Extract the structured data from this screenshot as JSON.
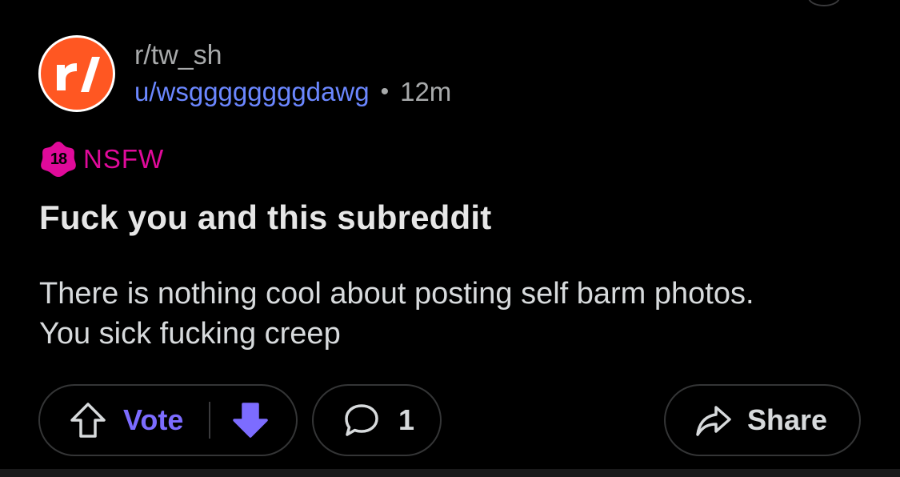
{
  "post": {
    "subreddit": "r/tw_sh",
    "username": "u/wsggggggggdawg",
    "separator": "•",
    "time_ago": "12m",
    "avatar_icon": "reddit-r-slash-logo",
    "avatar_color": "#ff5722",
    "nsfw": {
      "badge_number": "18",
      "label": "NSFW",
      "color": "#e00a9a"
    },
    "title": "Fuck you and this subreddit",
    "body": "There is nothing cool about posting self barm photos. You sick fucking creep"
  },
  "actions": {
    "upvote_icon": "arrow-up-outline-icon",
    "vote_label": "Vote",
    "downvote_icon": "arrow-down-filled-icon",
    "vote_color": "#7c6cff",
    "comment_icon": "speech-bubble-icon",
    "comment_count": "1",
    "share_icon": "share-arrow-icon",
    "share_label": "Share"
  }
}
